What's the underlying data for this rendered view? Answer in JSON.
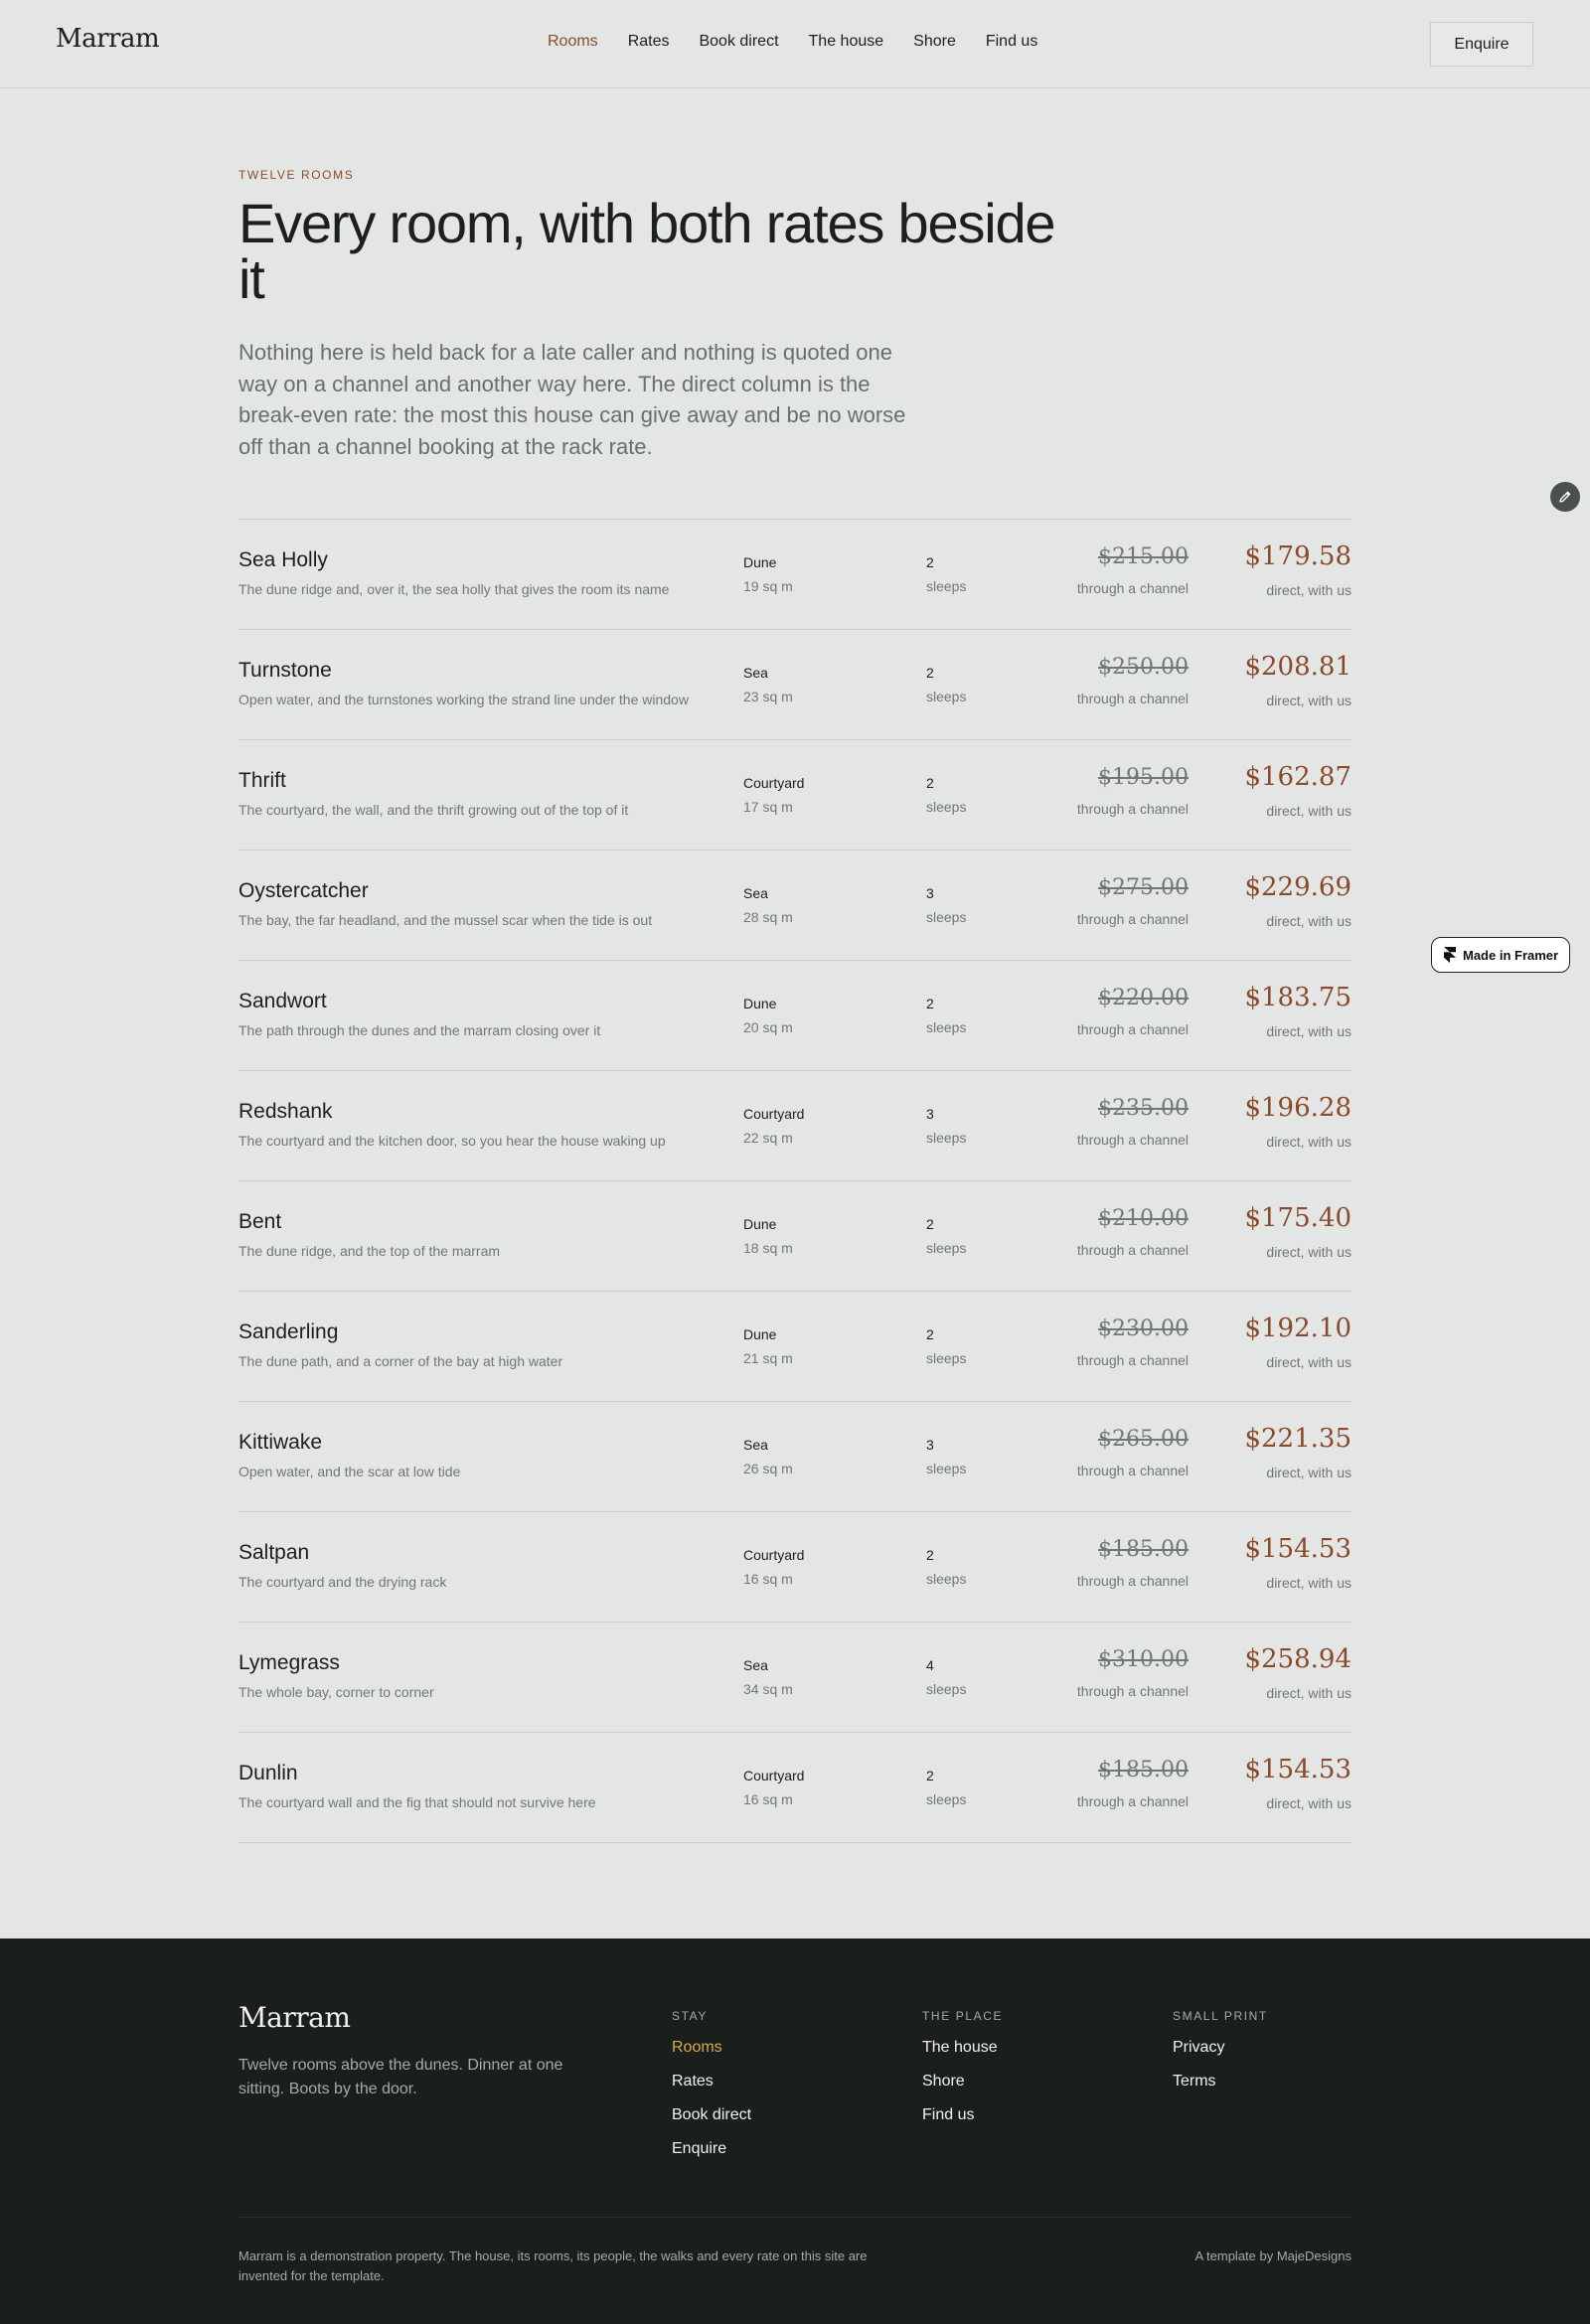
{
  "header": {
    "brand": "Marram",
    "nav": [
      "Rooms",
      "Rates",
      "Book direct",
      "The house",
      "Shore",
      "Find us"
    ],
    "active_nav": "Rooms",
    "enquire_label": "Enquire"
  },
  "hero": {
    "eyebrow": "TWELVE ROOMS",
    "title": "Every room, with both rates beside it",
    "lede": "Nothing here is held back for a late caller and nothing is quoted one way on a channel and another way here. The direct column is the break-even rate: the most this house can give away and be no worse off than a channel booking at the rack rate."
  },
  "labels": {
    "sleeps": "sleeps",
    "rack_caption": "through a channel",
    "direct_caption": "direct, with us"
  },
  "rooms": [
    {
      "name": "Sea Holly",
      "desc": "The dune ridge and, over it, the sea holly that gives the room its name",
      "view": "Dune",
      "size": "19 sq m",
      "sleeps": "2",
      "rack": "$215.00",
      "direct": "$179.58"
    },
    {
      "name": "Turnstone",
      "desc": "Open water, and the turnstones working the strand line under the window",
      "view": "Sea",
      "size": "23 sq m",
      "sleeps": "2",
      "rack": "$250.00",
      "direct": "$208.81"
    },
    {
      "name": "Thrift",
      "desc": "The courtyard, the wall, and the thrift growing out of the top of it",
      "view": "Courtyard",
      "size": "17 sq m",
      "sleeps": "2",
      "rack": "$195.00",
      "direct": "$162.87"
    },
    {
      "name": "Oystercatcher",
      "desc": "The bay, the far headland, and the mussel scar when the tide is out",
      "view": "Sea",
      "size": "28 sq m",
      "sleeps": "3",
      "rack": "$275.00",
      "direct": "$229.69"
    },
    {
      "name": "Sandwort",
      "desc": "The path through the dunes and the marram closing over it",
      "view": "Dune",
      "size": "20 sq m",
      "sleeps": "2",
      "rack": "$220.00",
      "direct": "$183.75"
    },
    {
      "name": "Redshank",
      "desc": "The courtyard and the kitchen door, so you hear the house waking up",
      "view": "Courtyard",
      "size": "22 sq m",
      "sleeps": "3",
      "rack": "$235.00",
      "direct": "$196.28"
    },
    {
      "name": "Bent",
      "desc": "The dune ridge, and the top of the marram",
      "view": "Dune",
      "size": "18 sq m",
      "sleeps": "2",
      "rack": "$210.00",
      "direct": "$175.40"
    },
    {
      "name": "Sanderling",
      "desc": "The dune path, and a corner of the bay at high water",
      "view": "Dune",
      "size": "21 sq m",
      "sleeps": "2",
      "rack": "$230.00",
      "direct": "$192.10"
    },
    {
      "name": "Kittiwake",
      "desc": "Open water, and the scar at low tide",
      "view": "Sea",
      "size": "26 sq m",
      "sleeps": "3",
      "rack": "$265.00",
      "direct": "$221.35"
    },
    {
      "name": "Saltpan",
      "desc": "The courtyard and the drying rack",
      "view": "Courtyard",
      "size": "16 sq m",
      "sleeps": "2",
      "rack": "$185.00",
      "direct": "$154.53"
    },
    {
      "name": "Lymegrass",
      "desc": "The whole bay, corner to corner",
      "view": "Sea",
      "size": "34 sq m",
      "sleeps": "4",
      "rack": "$310.00",
      "direct": "$258.94"
    },
    {
      "name": "Dunlin",
      "desc": "The courtyard wall and the fig that should not survive here",
      "view": "Courtyard",
      "size": "16 sq m",
      "sleeps": "2",
      "rack": "$185.00",
      "direct": "$154.53"
    }
  ],
  "badge": {
    "label": "Made in Framer",
    "icon": "framer-logo-icon"
  },
  "edit_icon": "pencil-icon",
  "footer": {
    "brand": "Marram",
    "tagline": "Twelve rooms above the dunes. Dinner at one sitting. Boots by the door.",
    "columns": [
      {
        "title": "STAY",
        "links": [
          "Rooms",
          "Rates",
          "Book direct",
          "Enquire"
        ]
      },
      {
        "title": "THE PLACE",
        "links": [
          "The house",
          "Shore",
          "Find us"
        ]
      },
      {
        "title": "SMALL PRINT",
        "links": [
          "Privacy",
          "Terms"
        ]
      }
    ],
    "note": "Marram is a demonstration property. The house, its rooms, its people, the walks and every rate on this site are invented for the template.",
    "credit": "A template by MajeDesigns"
  },
  "colors": {
    "background": "#e4e6e5",
    "accent": "#8a4a2a",
    "footer_bg": "#1a1f1e",
    "footer_active": "#d9a94a"
  }
}
